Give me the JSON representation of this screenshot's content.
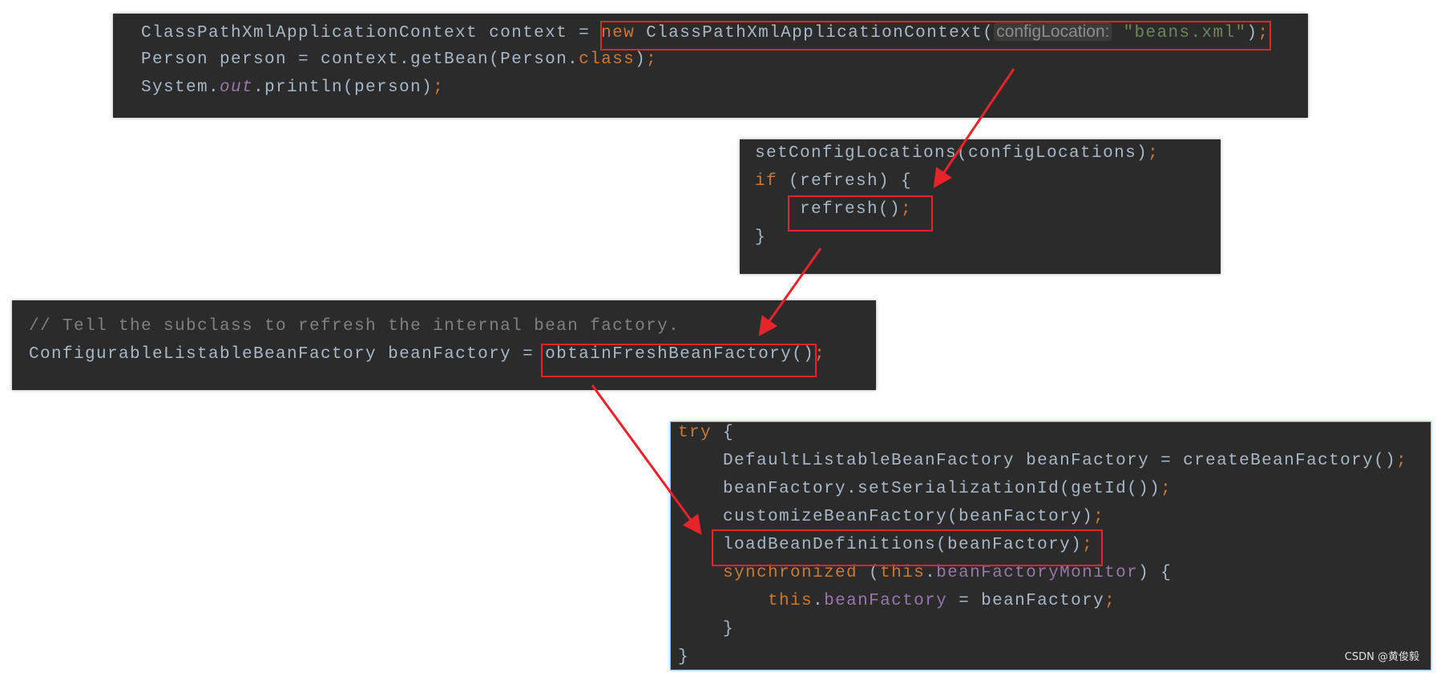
{
  "colors": {
    "background": "#2b2b2b",
    "default": "#a9b7c6",
    "keyword": "#cc7832",
    "string": "#6a8759",
    "comment": "#808080",
    "field": "#9876aa",
    "highlight": "#e8232a",
    "selection_border": "#8fb6ea"
  },
  "panels": [
    {
      "lines": [
        [
          [
            "",
            "ClassPathXmlApplicationContext context = "
          ],
          [
            "kw",
            "new"
          ],
          [
            "",
            " ClassPathXmlApplicationContext("
          ],
          [
            "hint",
            "configLocation:"
          ],
          [
            "",
            " "
          ],
          [
            "str",
            "\"beans.xml\""
          ],
          [
            "",
            ")"
          ],
          [
            "kw",
            ";"
          ]
        ],
        [
          [
            "",
            "Person person = context.getBean(Person."
          ],
          [
            "kw",
            "class"
          ],
          [
            "",
            ")"
          ],
          [
            "kw",
            ";"
          ]
        ],
        [
          [
            "",
            "System."
          ],
          [
            "static",
            "out"
          ],
          [
            "",
            ".println(person)"
          ],
          [
            "kw",
            ";"
          ]
        ]
      ]
    },
    {
      "lines": [
        [
          [
            "",
            "setConfigLocations(configLocations)"
          ],
          [
            "kw",
            ";"
          ]
        ],
        [
          [
            "kw",
            "if"
          ],
          [
            "",
            " (refresh) {"
          ]
        ],
        [
          [
            "",
            "    refresh()"
          ],
          [
            "kw",
            ";"
          ]
        ],
        [
          [
            "",
            "}"
          ]
        ]
      ]
    },
    {
      "lines": [
        [
          [
            "cm",
            "// Tell the subclass to refresh the internal bean factory."
          ]
        ],
        [
          [
            "",
            "ConfigurableListableBeanFactory beanFactory = obtainFreshBeanFactory()"
          ],
          [
            "kw",
            ";"
          ]
        ]
      ]
    },
    {
      "lines": [
        [
          [
            "kw",
            "try"
          ],
          [
            "",
            " {"
          ]
        ],
        [
          [
            "",
            "    DefaultListableBeanFactory beanFactory = createBeanFactory()"
          ],
          [
            "kw",
            ";"
          ]
        ],
        [
          [
            "",
            "    beanFactory.setSerializationId(getId())"
          ],
          [
            "kw",
            ";"
          ]
        ],
        [
          [
            "",
            "    customizeBeanFactory(beanFactory)"
          ],
          [
            "kw",
            ";"
          ]
        ],
        [
          [
            "",
            "    loadBeanDefinitions(beanFactory)"
          ],
          [
            "kw",
            ";"
          ]
        ],
        [
          [
            "",
            "    "
          ],
          [
            "kw",
            "synchronized"
          ],
          [
            "",
            " ("
          ],
          [
            "kw",
            "this"
          ],
          [
            "",
            "."
          ],
          [
            "field",
            "beanFactoryMonitor"
          ],
          [
            "",
            ") {"
          ]
        ],
        [
          [
            "",
            "        "
          ],
          [
            "kw",
            "this"
          ],
          [
            "",
            "."
          ],
          [
            "field",
            "beanFactory"
          ],
          [
            "",
            " = beanFactory"
          ],
          [
            "kw",
            ";"
          ]
        ],
        [
          [
            "",
            "    }"
          ]
        ],
        [
          [
            "",
            "}"
          ]
        ]
      ]
    }
  ],
  "watermark": "CSDN @黄俊毅"
}
